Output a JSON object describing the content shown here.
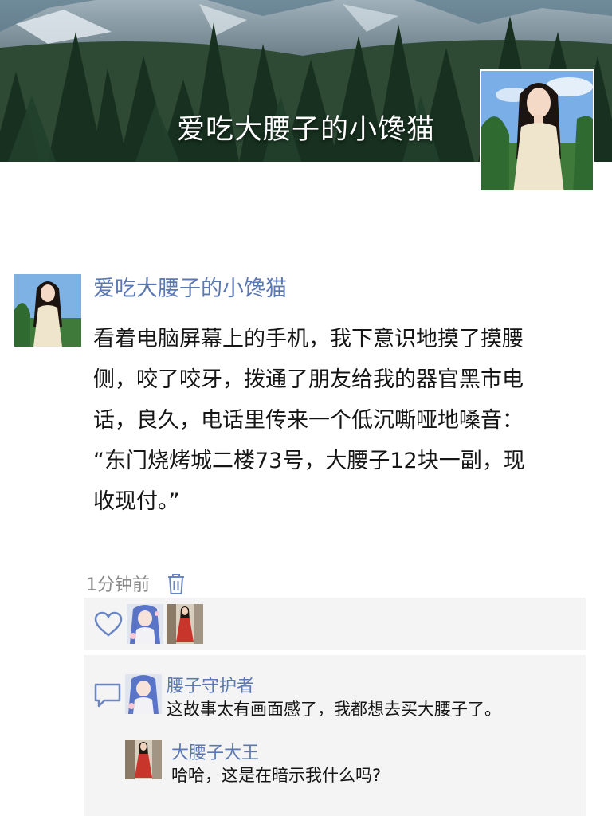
{
  "profile": {
    "cover_title": "爱吃大腰子的小馋猫"
  },
  "post": {
    "author": "爱吃大腰子的小馋猫",
    "lines": [
      "看着电脑屏幕上的手机，我下意识地摸了摸腰",
      "侧，咬了咬牙，拨通了朋友给我的器官黑市电",
      "话，良久，电话里传来一个低沉嘶哑地嗓音：",
      "“东门烧烤城二楼73号，大腰子12块一副，现",
      "收现付。”"
    ],
    "time": "1分钟前"
  },
  "likes": {
    "icon": "heart-icon",
    "avatars": [
      "blue-hair-anime-girl",
      "red-dress-girl"
    ]
  },
  "comments": [
    {
      "author": "腰子守护者",
      "text": "这故事太有画面感了，我都想去买大腰子了。",
      "avatar": "blue-hair-anime-girl"
    },
    {
      "author": "大腰子大王",
      "text": "哈哈，这是在暗示我什么吗?",
      "avatar": "red-dress-girl"
    }
  ],
  "colors": {
    "name_link": "#5b78b3",
    "panel_bg": "#f4f4f4",
    "time_gray": "#8a8a8a"
  }
}
